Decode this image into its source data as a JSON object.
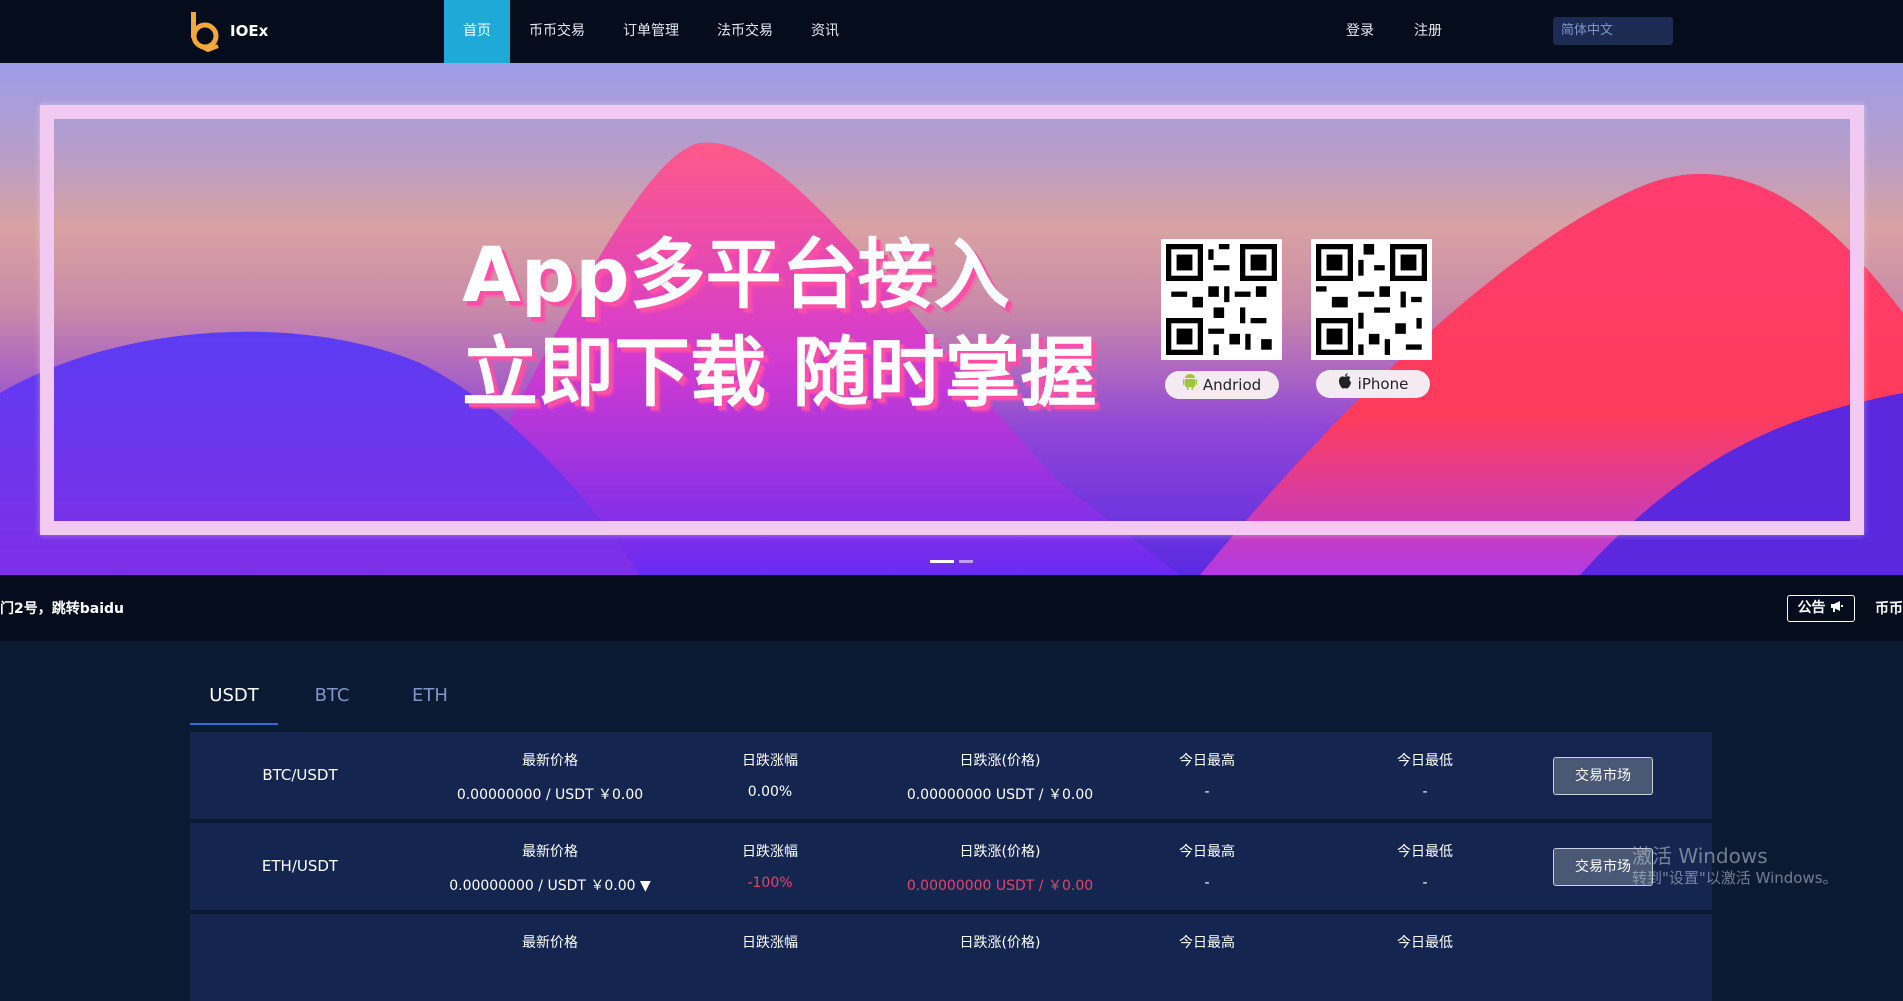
{
  "header": {
    "brand": "IOEx",
    "nav": [
      {
        "label": "首页",
        "active": true
      },
      {
        "label": "币币交易"
      },
      {
        "label": "订单管理"
      },
      {
        "label": "法币交易"
      },
      {
        "label": "资讯"
      }
    ],
    "login": "登录",
    "register": "注册",
    "language": "简体中文"
  },
  "banner": {
    "line1": "App多平台接入",
    "line2": "立即下载 随时掌握",
    "android_label": "Andriod",
    "iphone_label": "iPhone",
    "slides": 2,
    "active_slide": 1
  },
  "notice": {
    "text": "门2号，跳转baidu",
    "button": "公告",
    "right_text": "币币"
  },
  "market": {
    "tabs": [
      {
        "label": "USDT",
        "active": true
      },
      {
        "label": "BTC"
      },
      {
        "label": "ETH"
      }
    ],
    "columns": {
      "last_price": "最新价格",
      "change_pct": "日跌涨幅",
      "change_price": "日跌涨(价格)",
      "high": "今日最高",
      "low": "今日最低"
    },
    "trade_button": "交易市场",
    "rows": [
      {
        "pair": "BTC/USDT",
        "last_price": "0.00000000 / USDT ￥0.00",
        "change_pct": "0.00%",
        "change_price": "0.00000000 USDT / ￥0.00",
        "high": "-",
        "low": "-",
        "down": false
      },
      {
        "pair": "ETH/USDT",
        "last_price": "0.00000000 / USDT ￥0.00 ▼",
        "change_pct": "-100%",
        "change_price": "0.00000000 USDT / ￥0.00",
        "high": "-",
        "low": "-",
        "down": true
      },
      {
        "pair": "",
        "last_price": "",
        "change_pct": "",
        "change_price": "",
        "high": "",
        "low": "",
        "down": false
      }
    ]
  },
  "watermark": {
    "line1": "激活 Windows",
    "line2": "转到\"设置\"以激活 Windows。"
  }
}
